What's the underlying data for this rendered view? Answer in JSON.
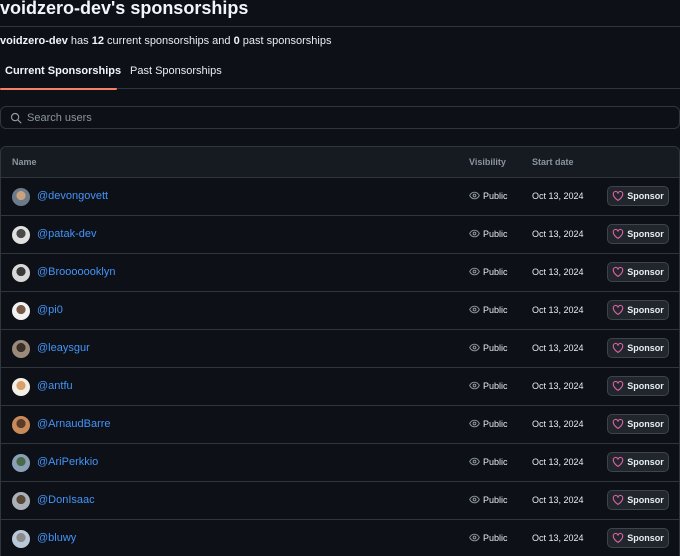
{
  "header": {
    "title": "voidzero-dev's sponsorships",
    "summary_org": "voidzero-dev",
    "summary_has": " has ",
    "summary_current_count": "12",
    "summary_mid": " current sponsorships and ",
    "summary_past_count": "0",
    "summary_end": " past sponsorships"
  },
  "tabs": {
    "current": "Current Sponsorships",
    "past": "Past Sponsorships"
  },
  "search": {
    "placeholder": "Search users",
    "value": ""
  },
  "table": {
    "columns": {
      "name": "Name",
      "visibility": "Visibility",
      "start_date": "Start date"
    },
    "rows": [
      {
        "login": "@devongovett",
        "visibility": "Public",
        "date": "Oct 13, 2024",
        "button": "Sponsor"
      },
      {
        "login": "@patak-dev",
        "visibility": "Public",
        "date": "Oct 13, 2024",
        "button": "Sponsor"
      },
      {
        "login": "@Brooooooklyn",
        "visibility": "Public",
        "date": "Oct 13, 2024",
        "button": "Sponsor"
      },
      {
        "login": "@pi0",
        "visibility": "Public",
        "date": "Oct 13, 2024",
        "button": "Sponsor"
      },
      {
        "login": "@leaysgur",
        "visibility": "Public",
        "date": "Oct 13, 2024",
        "button": "Sponsor"
      },
      {
        "login": "@antfu",
        "visibility": "Public",
        "date": "Oct 13, 2024",
        "button": "Sponsor"
      },
      {
        "login": "@ArnaudBarre",
        "visibility": "Public",
        "date": "Oct 13, 2024",
        "button": "Sponsor"
      },
      {
        "login": "@AriPerkkio",
        "visibility": "Public",
        "date": "Oct 13, 2024",
        "button": "Sponsor"
      },
      {
        "login": "@DonIsaac",
        "visibility": "Public",
        "date": "Oct 13, 2024",
        "button": "Sponsor"
      },
      {
        "login": "@bluwy",
        "visibility": "Public",
        "date": "Oct 13, 2024",
        "button": "Sponsor"
      }
    ]
  },
  "colors": {
    "background": "#0d1117",
    "link": "#4493f8",
    "tab_underline": "#f78166",
    "heart": "#db61a2",
    "border": "#30363d"
  },
  "icons": {
    "search": "search-icon",
    "visibility": "eye-icon",
    "sponsor": "heart-icon"
  }
}
